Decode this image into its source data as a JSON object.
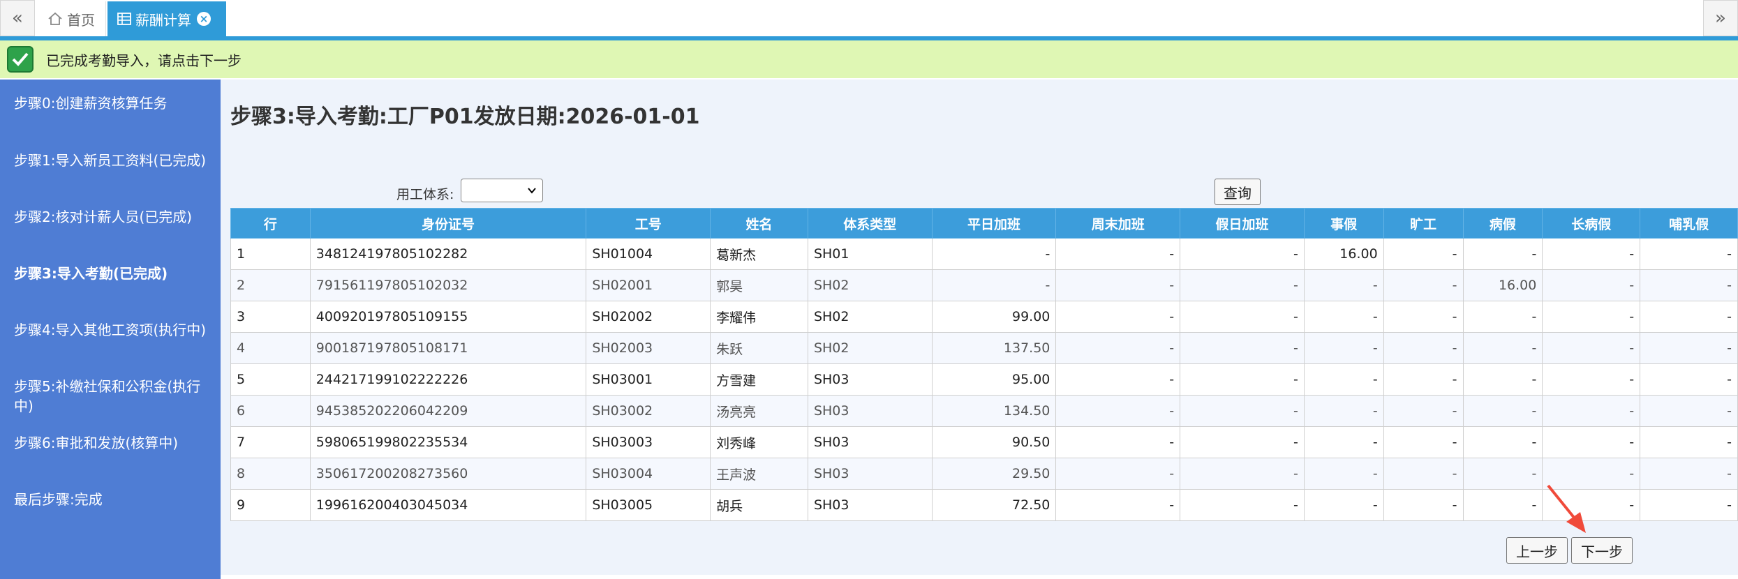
{
  "tabs": {
    "home_label": "首页",
    "active_label": "薪酬计算"
  },
  "message": "已完成考勤导入，请点击下一步",
  "steps": [
    "步骤0:创建薪资核算任务",
    "步骤1:导入新员工资料(已完成)",
    "步骤2:核对计薪人员(已完成)",
    "步骤3:导入考勤(已完成)",
    "步骤4:导入其他工资项(执行中)",
    "步骤5:补缴社保和公积金(执行中)",
    "步骤6:审批和发放(核算中)",
    "最后步骤:完成"
  ],
  "page_title": "步骤3:导入考勤:工厂P01发放日期:2026-01-01",
  "filter": {
    "label": "用工体系:",
    "selected": ""
  },
  "query_label": "查询",
  "table": {
    "columns": [
      "行",
      "身份证号",
      "工号",
      "姓名",
      "体系类型",
      "平日加班",
      "周末加班",
      "假日加班",
      "事假",
      "旷工",
      "病假",
      "长病假",
      "哺乳假"
    ],
    "rows": [
      [
        "1",
        "348124197805102282",
        "SH01004",
        "葛新杰",
        "SH01",
        "-",
        "-",
        "-",
        "16.00",
        "-",
        "-",
        "-",
        "-"
      ],
      [
        "2",
        "791561197805102032",
        "SH02001",
        "郭昊",
        "SH02",
        "-",
        "-",
        "-",
        "-",
        "-",
        "16.00",
        "-",
        "-"
      ],
      [
        "3",
        "400920197805109155",
        "SH02002",
        "李耀伟",
        "SH02",
        "99.00",
        "-",
        "-",
        "-",
        "-",
        "-",
        "-",
        "-"
      ],
      [
        "4",
        "900187197805108171",
        "SH02003",
        "朱跃",
        "SH02",
        "137.50",
        "-",
        "-",
        "-",
        "-",
        "-",
        "-",
        "-"
      ],
      [
        "5",
        "244217199102222226",
        "SH03001",
        "方雪建",
        "SH03",
        "95.00",
        "-",
        "-",
        "-",
        "-",
        "-",
        "-",
        "-"
      ],
      [
        "6",
        "945385202206042209",
        "SH03002",
        "汤亮亮",
        "SH03",
        "134.50",
        "-",
        "-",
        "-",
        "-",
        "-",
        "-",
        "-"
      ],
      [
        "7",
        "598065199802235534",
        "SH03003",
        "刘秀峰",
        "SH03",
        "90.50",
        "-",
        "-",
        "-",
        "-",
        "-",
        "-",
        "-"
      ],
      [
        "8",
        "350617200208273560",
        "SH03004",
        "王声波",
        "SH03",
        "29.50",
        "-",
        "-",
        "-",
        "-",
        "-",
        "-",
        "-"
      ],
      [
        "9",
        "199616200403045034",
        "SH03005",
        "胡兵",
        "SH03",
        "72.50",
        "-",
        "-",
        "-",
        "-",
        "-",
        "-",
        "-"
      ]
    ]
  },
  "buttons": {
    "prev": "上一步",
    "next": "下一步"
  },
  "colors": {
    "tab_active": "#2f9bd8",
    "sidebar": "#4f7dd4",
    "message_bg": "#dff7b4",
    "table_header": "#3c9ddb",
    "annotation_arrow": "#f04a3a"
  }
}
